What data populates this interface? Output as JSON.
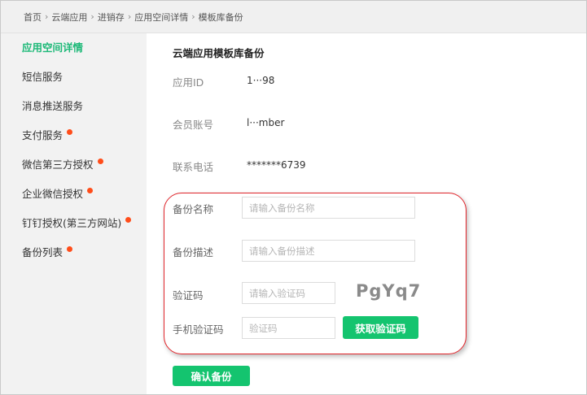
{
  "breadcrumb": [
    "首页",
    "云端应用",
    "进销存",
    "应用空间详情",
    "模板库备份"
  ],
  "sidebar": {
    "items": [
      {
        "label": "应用空间详情",
        "badge": false,
        "active": true
      },
      {
        "label": "短信服务",
        "badge": false,
        "active": false
      },
      {
        "label": "消息推送服务",
        "badge": false,
        "active": false
      },
      {
        "label": "支付服务",
        "badge": true,
        "active": false
      },
      {
        "label": "微信第三方授权",
        "badge": true,
        "active": false
      },
      {
        "label": "企业微信授权",
        "badge": true,
        "active": false
      },
      {
        "label": "钉钉授权(第三方网站)",
        "badge": true,
        "active": false
      },
      {
        "label": "备份列表",
        "badge": true,
        "active": false
      }
    ]
  },
  "main": {
    "title": "云端应用模板库备份",
    "info": [
      {
        "label": "应用ID",
        "value": "1···98"
      },
      {
        "label": "会员账号",
        "value": "l···mber"
      },
      {
        "label": "联系电话",
        "value": "*******6739"
      }
    ],
    "form": {
      "backup_name": {
        "label": "备份名称",
        "placeholder": "请输入备份名称"
      },
      "backup_desc": {
        "label": "备份描述",
        "placeholder": "请输入备份描述"
      },
      "captcha": {
        "label": "验证码",
        "placeholder": "请输入验证码",
        "image_text": "PgYq7"
      },
      "sms_code": {
        "label": "手机验证码",
        "placeholder": "验证码",
        "button": "获取验证码"
      }
    },
    "confirm_button": "确认备份"
  },
  "colors": {
    "accent": "#14c46f",
    "active_nav": "#1db978",
    "badge": "#ff4d1a",
    "highlight": "#e0242a"
  }
}
